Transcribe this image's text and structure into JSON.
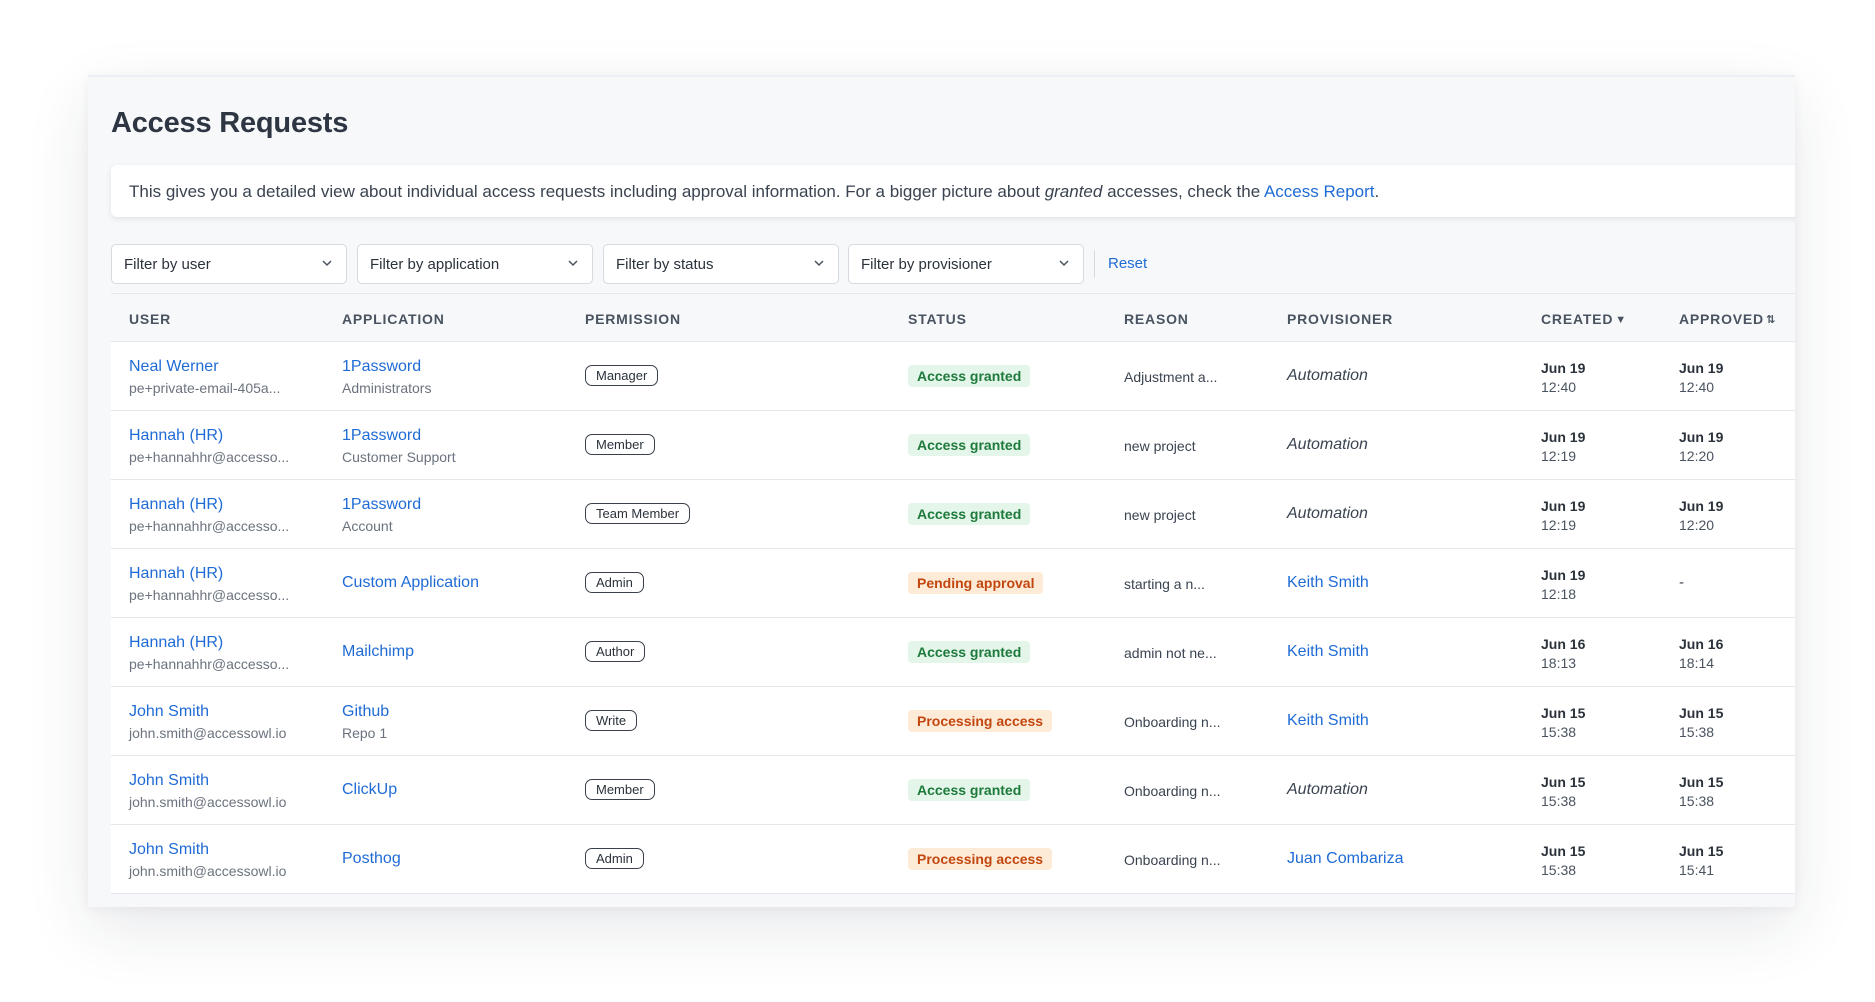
{
  "page": {
    "title": "Access Requests",
    "info": {
      "text_before": "This gives you a detailed view about individual access requests including approval information. For a bigger picture about ",
      "emphasis": "granted",
      "text_after": " accesses, check the ",
      "link": "Access Report",
      "period": "."
    }
  },
  "filters": {
    "user": "Filter by user",
    "application": "Filter by application",
    "status": "Filter by status",
    "provisioner": "Filter by provisioner",
    "reset": "Reset"
  },
  "columns": {
    "user": "User",
    "application": "Application",
    "permission": "Permission",
    "status": "Status",
    "reason": "Reason",
    "provisioner": "Provisioner",
    "created": "Created",
    "approved": "Approved"
  },
  "icons": {
    "created_sort": "sort-desc-icon",
    "approved_sort": "sort-icon",
    "filter_chevron": "chevron-down-icon"
  },
  "colors": {
    "link": "#1f6bd6",
    "granted_bg": "#e4f6e9",
    "granted_fg": "#1e7a3c",
    "pending_bg": "#fdebd8",
    "pending_fg": "#c2470f"
  },
  "rows": [
    {
      "user_name": "Neal Werner",
      "user_email": "pe+private-email-405a...",
      "app_name": "1Password",
      "app_sub": "Administrators",
      "permission": "Manager",
      "status": "Access granted",
      "status_kind": "granted",
      "reason": "Adjustment a...",
      "provisioner": "Automation",
      "provisioner_kind": "auto",
      "created_date": "Jun 19",
      "created_time": "12:40",
      "approved_date": "Jun 19",
      "approved_time": "12:40"
    },
    {
      "user_name": "Hannah (HR)",
      "user_email": "pe+hannahhr@accesso...",
      "app_name": "1Password",
      "app_sub": "Customer Support",
      "permission": "Member",
      "status": "Access granted",
      "status_kind": "granted",
      "reason": "new project",
      "provisioner": "Automation",
      "provisioner_kind": "auto",
      "created_date": "Jun 19",
      "created_time": "12:19",
      "approved_date": "Jun 19",
      "approved_time": "12:20"
    },
    {
      "user_name": "Hannah (HR)",
      "user_email": "pe+hannahhr@accesso...",
      "app_name": "1Password",
      "app_sub": "Account",
      "permission": "Team Member",
      "status": "Access granted",
      "status_kind": "granted",
      "reason": "new project",
      "provisioner": "Automation",
      "provisioner_kind": "auto",
      "created_date": "Jun 19",
      "created_time": "12:19",
      "approved_date": "Jun 19",
      "approved_time": "12:20"
    },
    {
      "user_name": "Hannah (HR)",
      "user_email": "pe+hannahhr@accesso...",
      "app_name": "Custom Application",
      "app_sub": "",
      "permission": "Admin",
      "status": "Pending approval",
      "status_kind": "pending",
      "reason": "starting a n...",
      "provisioner": "Keith Smith",
      "provisioner_kind": "person",
      "created_date": "Jun 19",
      "created_time": "12:18",
      "approved_date": "-",
      "approved_time": ""
    },
    {
      "user_name": "Hannah (HR)",
      "user_email": "pe+hannahhr@accesso...",
      "app_name": "Mailchimp",
      "app_sub": "",
      "permission": "Author",
      "status": "Access granted",
      "status_kind": "granted",
      "reason": "admin not ne...",
      "provisioner": "Keith Smith",
      "provisioner_kind": "person",
      "created_date": "Jun 16",
      "created_time": "18:13",
      "approved_date": "Jun 16",
      "approved_time": "18:14"
    },
    {
      "user_name": "John Smith",
      "user_email": "john.smith@accessowl.io",
      "app_name": "Github",
      "app_sub": "Repo 1",
      "permission": "Write",
      "status": "Processing access",
      "status_kind": "processing",
      "reason": "Onboarding n...",
      "provisioner": "Keith Smith",
      "provisioner_kind": "person",
      "created_date": "Jun 15",
      "created_time": "15:38",
      "approved_date": "Jun 15",
      "approved_time": "15:38"
    },
    {
      "user_name": "John Smith",
      "user_email": "john.smith@accessowl.io",
      "app_name": "ClickUp",
      "app_sub": "",
      "permission": "Member",
      "status": "Access granted",
      "status_kind": "granted",
      "reason": "Onboarding n...",
      "provisioner": "Automation",
      "provisioner_kind": "auto",
      "created_date": "Jun 15",
      "created_time": "15:38",
      "approved_date": "Jun 15",
      "approved_time": "15:38"
    },
    {
      "user_name": "John Smith",
      "user_email": "john.smith@accessowl.io",
      "app_name": "Posthog",
      "app_sub": "",
      "permission": "Admin",
      "status": "Processing access",
      "status_kind": "processing",
      "reason": "Onboarding n...",
      "provisioner": "Juan Combariza",
      "provisioner_kind": "person",
      "created_date": "Jun 15",
      "created_time": "15:38",
      "approved_date": "Jun 15",
      "approved_time": "15:41"
    }
  ]
}
